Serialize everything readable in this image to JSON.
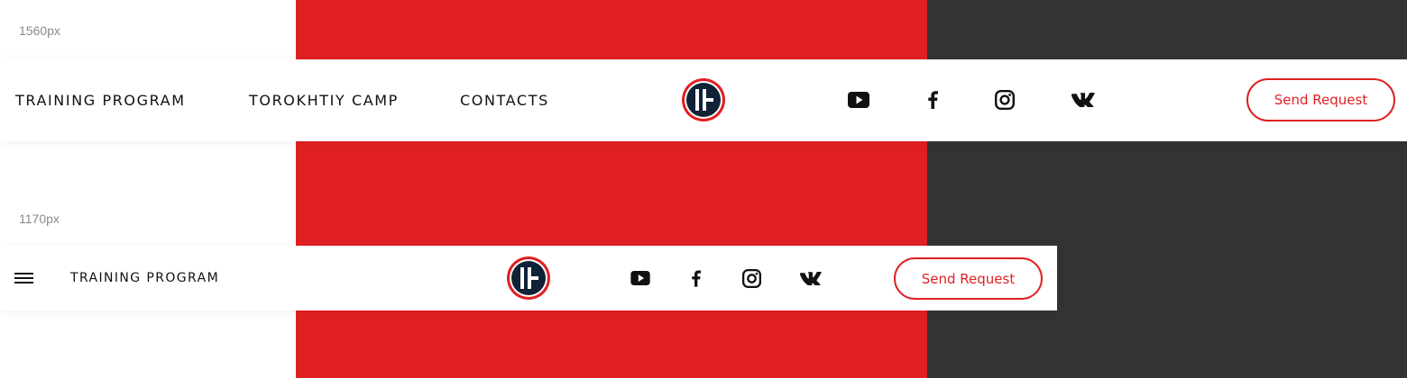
{
  "labels": {
    "wide": "1560px",
    "narrow": "1170px"
  },
  "colors": {
    "accent": "#e01f22",
    "dark": "#333333",
    "logo_navy": "#0f2236"
  },
  "header_wide": {
    "nav": [
      "TRAINING PROGRAM",
      "TOROKHTIY CAMP",
      "CONTACTS"
    ],
    "socials": [
      "youtube-icon",
      "facebook-icon",
      "instagram-icon",
      "vk-icon"
    ],
    "button": "Send Request"
  },
  "header_narrow": {
    "menu_icon": "menu-icon",
    "nav": [
      "TRAINING PROGRAM"
    ],
    "socials": [
      "youtube-icon",
      "facebook-icon",
      "instagram-icon",
      "vk-icon"
    ],
    "button": "Send Request"
  }
}
